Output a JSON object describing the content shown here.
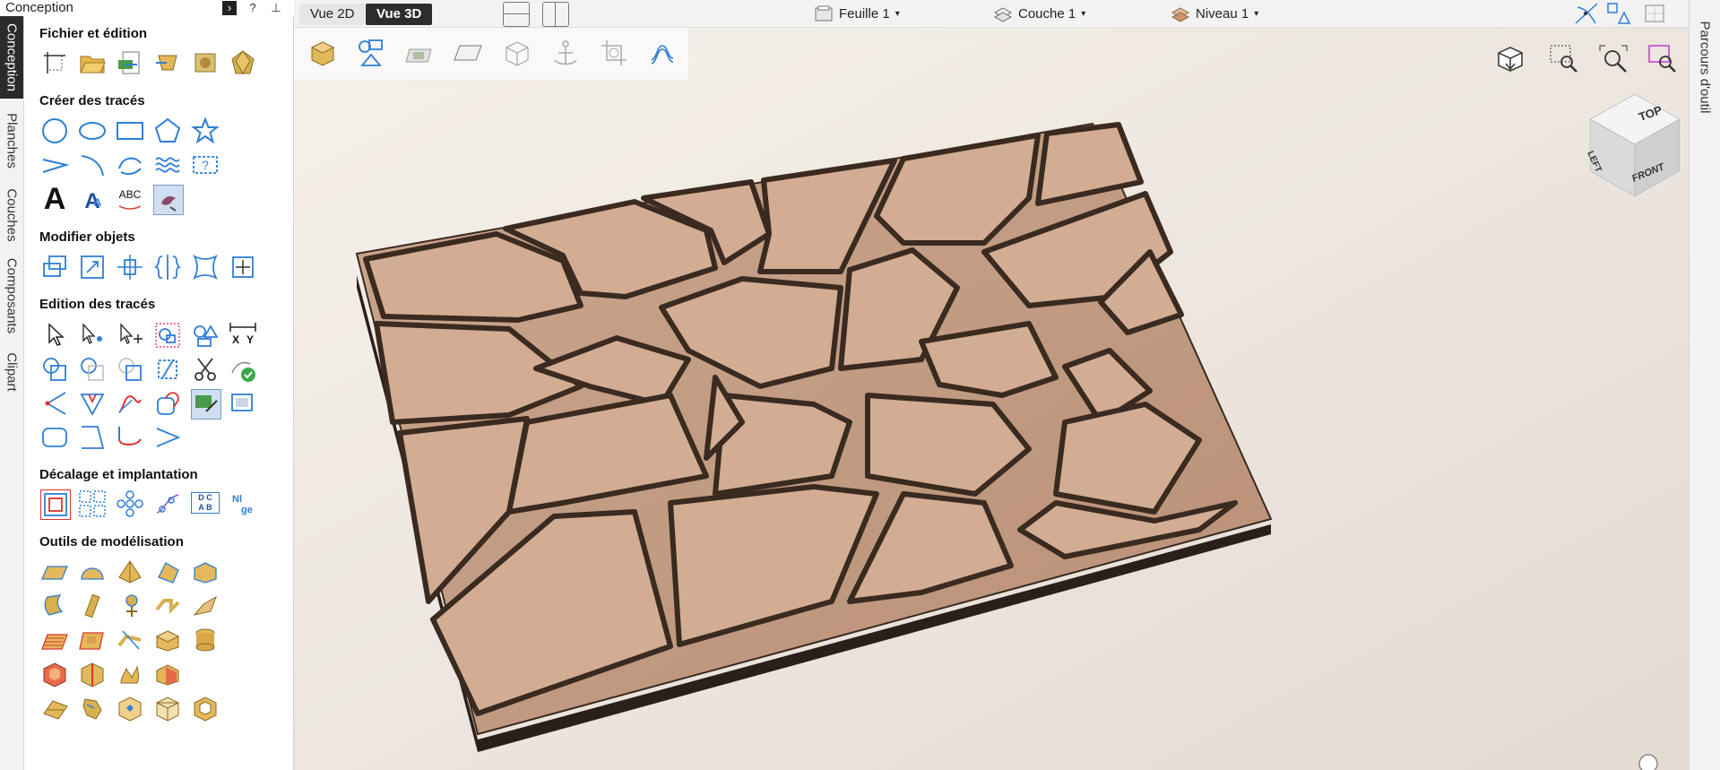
{
  "panel": {
    "title": "Conception",
    "help_label": "?",
    "sections": [
      {
        "title": "Fichier et édition"
      },
      {
        "title": "Créer des tracés"
      },
      {
        "title": "Modifier objets"
      },
      {
        "title": "Edition des tracés"
      },
      {
        "title": "Décalage et implantation"
      },
      {
        "title": "Outils de modélisation"
      }
    ],
    "text_tools": {
      "big_a": "A",
      "abc": "ABC",
      "xy_x": "X",
      "xy_y": "Y",
      "dc": "D C",
      "ab": "A B"
    }
  },
  "vtabs": [
    {
      "label": "Conception",
      "active": true
    },
    {
      "label": "Planches",
      "active": false
    },
    {
      "label": "Couches",
      "active": false
    },
    {
      "label": "Composants",
      "active": false
    },
    {
      "label": "Clipart",
      "active": false
    }
  ],
  "topbar": {
    "view_2d": "Vue 2D",
    "view_3d": "Vue 3D",
    "sheet": "Feuille 1",
    "layer": "Couche 1",
    "level": "Niveau 1"
  },
  "right_panel": {
    "label": "Parcours d'outil"
  },
  "viewcube": {
    "top": "TOP",
    "left": "LEFT",
    "front": "FRONT"
  },
  "colors": {
    "accent_blue": "#2f7fd6",
    "relief": "#c9a38a",
    "active_tab": "#2b2b2b"
  }
}
